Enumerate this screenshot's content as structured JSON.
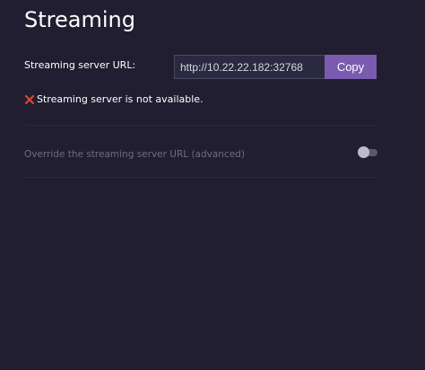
{
  "page": {
    "title": "Streaming"
  },
  "server_url": {
    "label": "Streaming server URL:",
    "value": "http://10.22.22.182:32768",
    "copy_label": "Copy"
  },
  "status": {
    "icon": "close-icon",
    "text": "Streaming server is not available.",
    "icon_color": "#e0442c"
  },
  "override": {
    "label": "Override the streaming server URL (advanced)",
    "enabled": false
  },
  "colors": {
    "background": "#201e30",
    "accent": "#7b5bb0"
  }
}
